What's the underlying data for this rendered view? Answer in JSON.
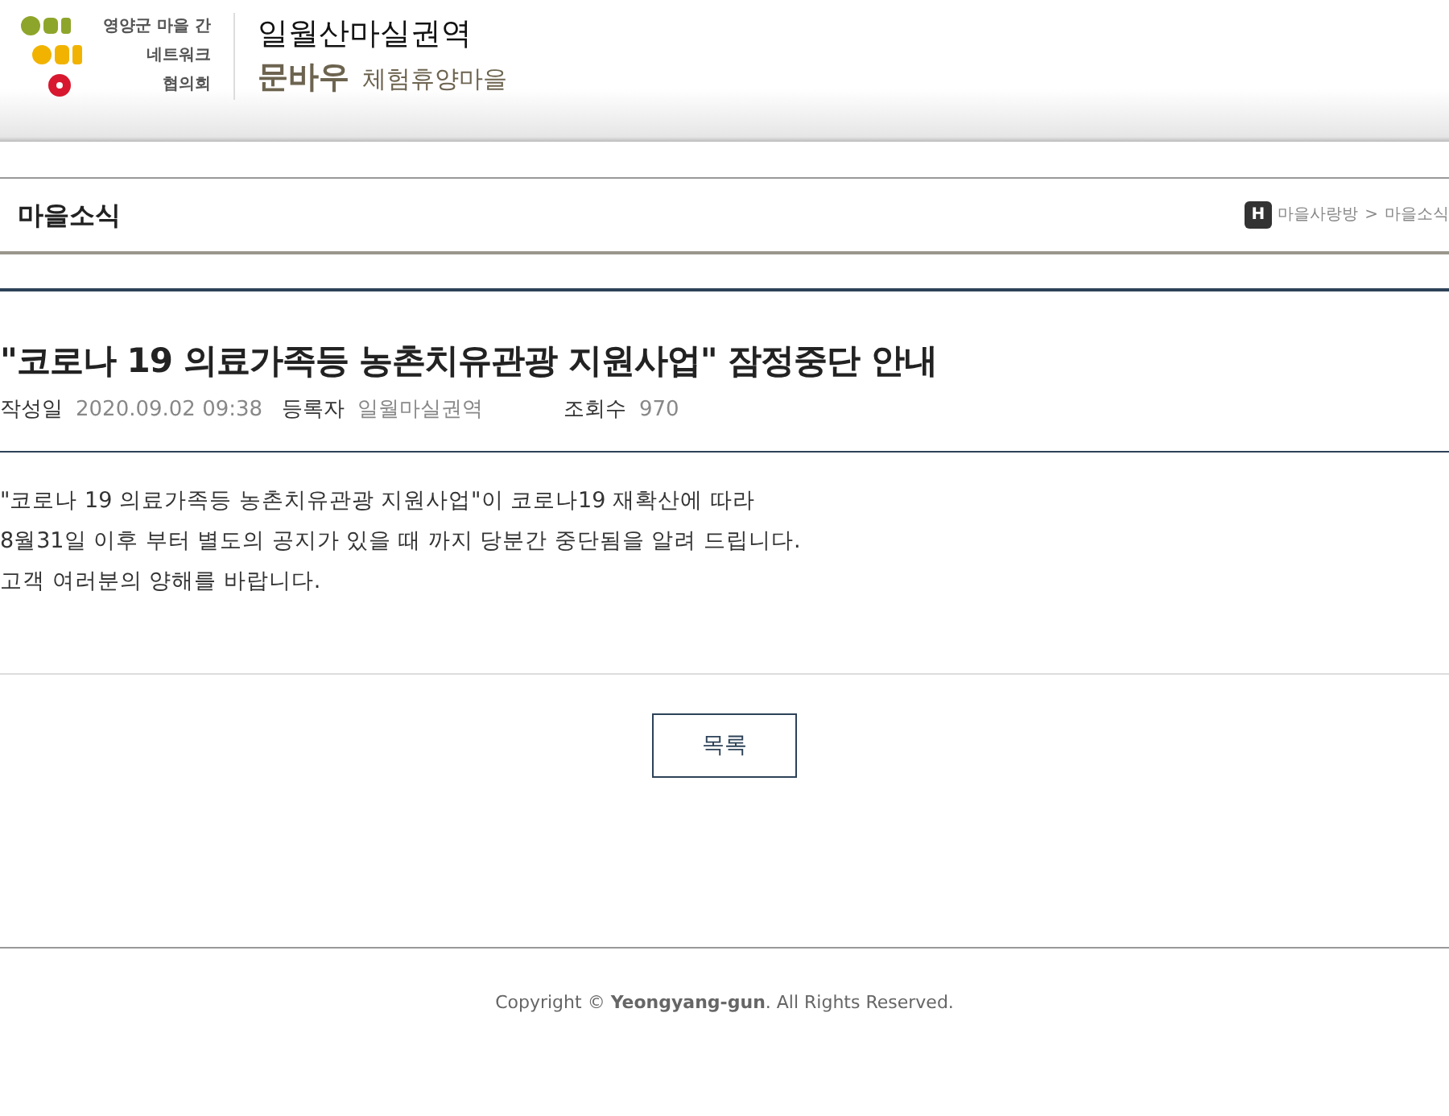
{
  "header": {
    "logo_lines": [
      "영양군 마을 간",
      "네트워크",
      "협의회"
    ],
    "site_title": "일월산마실권역",
    "brand": "문바우",
    "subtitle": "체험휴양마을"
  },
  "section": {
    "title": "마을소식",
    "breadcrumb": [
      "마을사랑방",
      "마을소식"
    ],
    "home_badge": "H",
    "separator": ">"
  },
  "post": {
    "title": "\"코로나 19 의료가족등 농촌치유관광 지원사업\" 잠정중단 안내",
    "meta": [
      {
        "label": "작성일",
        "value": "2020.09.02 09:38"
      },
      {
        "label": "등록자",
        "value": "일월마실권역"
      },
      {
        "label": "조회수",
        "value": "970"
      }
    ],
    "body": [
      "\"코로나 19 의료가족등 농촌치유관광 지원사업\"이 코로나19 재확산에 따라",
      "8월31일 이후 부터 별도의 공지가 있을 때 까지 당분간 중단됨을 알려 드립니다.",
      "고객 여러분의 양해를 바랍니다."
    ]
  },
  "list_button": "목록",
  "footer": "Copyright © **Yeongyang-gun**. All Rights Reserved."
}
